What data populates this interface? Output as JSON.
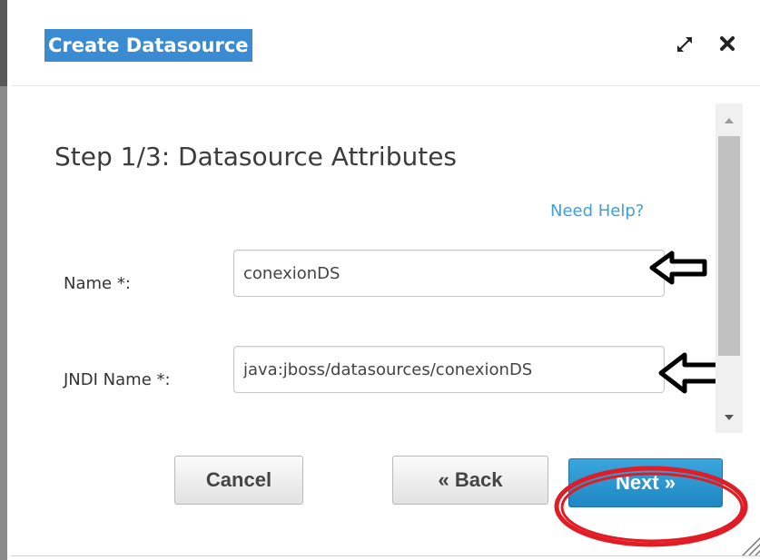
{
  "dialog": {
    "title": "Create Datasource",
    "maximize_icon": "maximize-icon",
    "close_icon": "close-icon"
  },
  "step": {
    "title": "Step 1/3: Datasource Attributes"
  },
  "help_link": "Need Help?",
  "fields": {
    "name": {
      "label": "Name *:",
      "value": "conexionDS"
    },
    "jndi_name": {
      "label": "JNDI Name *:",
      "value": "java:jboss/datasources/conexionDS"
    }
  },
  "buttons": {
    "cancel": "Cancel",
    "back": "« Back",
    "next": "Next »"
  },
  "annotations": {
    "arrow_icon": "left-arrow-annotation-icon",
    "highlight_icon": "red-ellipse-annotation",
    "highlight_color": "#e11c25"
  },
  "colors": {
    "title_highlight": "#3b8bd3",
    "link": "#3fa0d5",
    "primary_button": "#2b97d1"
  }
}
